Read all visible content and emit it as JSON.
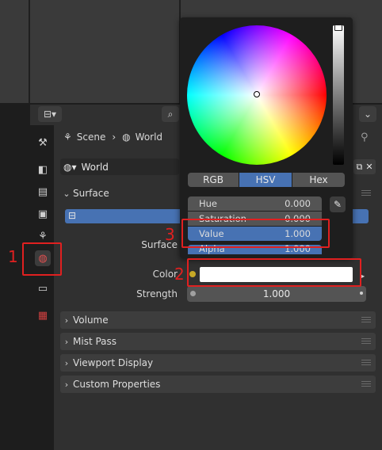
{
  "breadcrumb": {
    "scene": "Scene",
    "world": "World"
  },
  "world_selector": {
    "name": "World"
  },
  "panels": {
    "surface": "Surface",
    "volume": "Volume",
    "mist_pass": "Mist Pass",
    "viewport_display": "Viewport Display",
    "custom_properties": "Custom Properties"
  },
  "surface": {
    "surface_label": "Surface",
    "color_label": "Color",
    "strength_label": "Strength",
    "strength_value": "1.000"
  },
  "color_picker": {
    "modes": [
      "RGB",
      "HSV",
      "Hex"
    ],
    "active_mode": "HSV",
    "hue_label": "Hue",
    "hue_value": "0.000",
    "saturation_label": "Saturation",
    "saturation_value": "0.000",
    "value_label": "Value",
    "value_value": "1.000",
    "alpha_label": "Alpha",
    "alpha_value": "1.000"
  },
  "annotations": {
    "n1": "1",
    "n2": "2",
    "n3": "3"
  },
  "colors": {
    "accent": "#4772b3",
    "annotation_red": "#e02020",
    "panel_bg": "#303030"
  },
  "icons": [
    "tool-icon",
    "render-icon",
    "output-icon",
    "view-layer-icon",
    "scene-icon",
    "world-icon",
    "collection-icon",
    "texture-icon",
    "search-icon",
    "pin-icon",
    "eyedropper-icon"
  ]
}
